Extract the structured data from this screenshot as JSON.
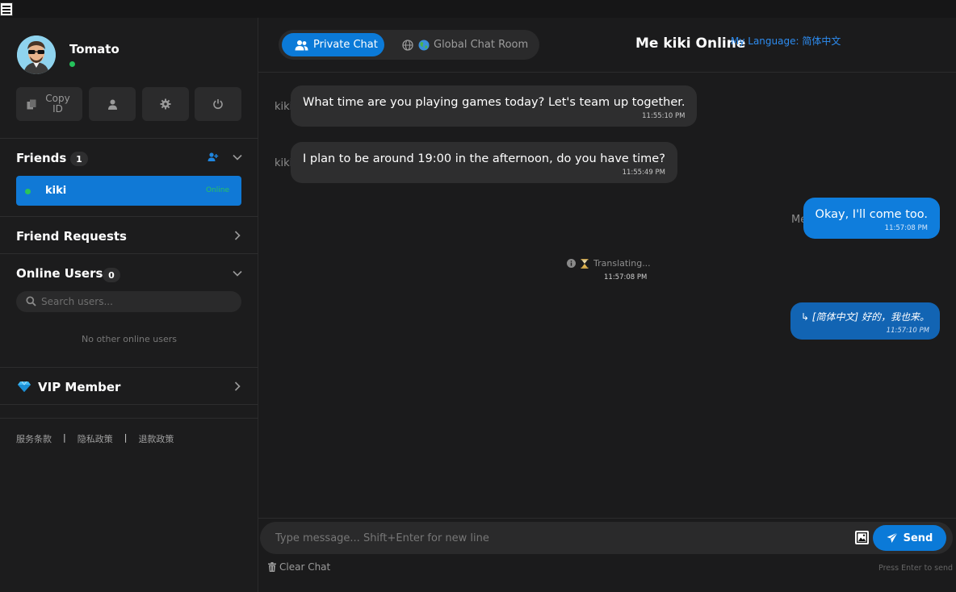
{
  "user": {
    "name": "Tomato",
    "status_color": "#25c25b"
  },
  "actions": {
    "copy_id": "Copy ID",
    "profile_icon": "user-icon",
    "settings_icon": "gear-icon",
    "power_icon": "power-icon"
  },
  "friends": {
    "title": "Friends",
    "count": "1",
    "items": [
      {
        "name": "kiki",
        "status": "Online"
      }
    ]
  },
  "friend_requests": {
    "title": "Friend Requests"
  },
  "online_users": {
    "title": "Online Users",
    "count": "0",
    "search_placeholder": "Search users...",
    "empty_text": "No other online users"
  },
  "vip": {
    "title": "VIP Member"
  },
  "footer": {
    "links": [
      "服务条款",
      "隐私政策",
      "退款政策"
    ]
  },
  "header": {
    "tab_private": "Private Chat",
    "tab_global": "Global Chat Room",
    "chat_title": "Me kiki Online",
    "language_label": "My Language: 简体中文"
  },
  "messages": [
    {
      "sender": "kiki",
      "text": "What time are you playing games today? Let's team up together.",
      "time": "11:55:10 PM",
      "direction": "in"
    },
    {
      "sender": "kiki",
      "text": "I plan to be around 19:00 in the afternoon, do you have time?",
      "time": "11:55:49 PM",
      "direction": "in"
    },
    {
      "sender": "Me",
      "text": "Okay, I'll come too.",
      "time": "11:57:08 PM",
      "direction": "out"
    },
    {
      "system": "Translating...",
      "time": "11:57:08 PM"
    },
    {
      "text": "↳ [简体中文] 好的，我也来。",
      "time": "11:57:10 PM",
      "direction": "translated"
    }
  ],
  "composer": {
    "placeholder": "Type message... Shift+Enter for new line",
    "send_label": "Send",
    "clear_label": "Clear Chat",
    "hint": "Press Enter to send"
  },
  "colors": {
    "accent": "#0b7ad8",
    "online": "#2bc45a",
    "link": "#2d8cf0"
  }
}
